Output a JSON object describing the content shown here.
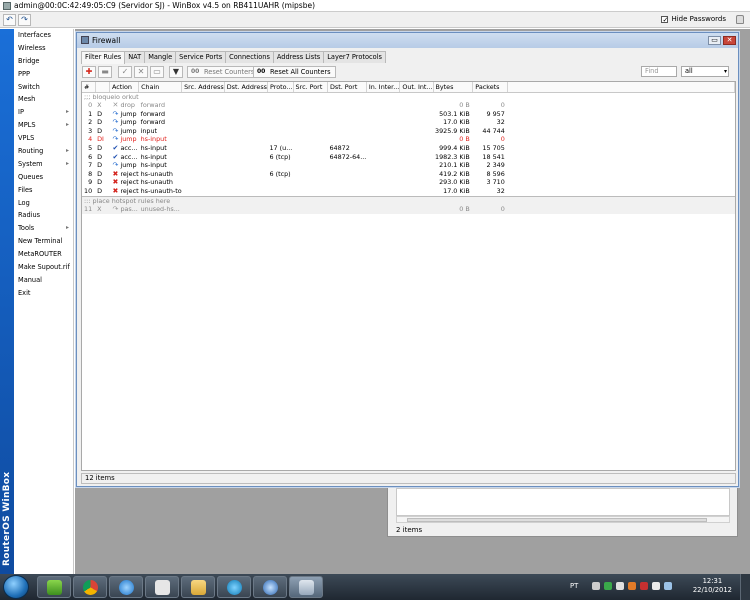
{
  "window": {
    "title": "admin@00:0C:42:49:05:C9 (Servidor SJ) - WinBox v4.5 on RB411UAHR (mipsbe)",
    "hide_passwords_label": "Hide Passwords",
    "hide_passwords_checked": "✓"
  },
  "brand": "RouterOS WinBox",
  "sidebar": {
    "items": [
      {
        "label": "Interfaces"
      },
      {
        "label": "Wireless"
      },
      {
        "label": "Bridge"
      },
      {
        "label": "PPP"
      },
      {
        "label": "Switch"
      },
      {
        "label": "Mesh"
      },
      {
        "label": "IP",
        "submenu": "▸"
      },
      {
        "label": "MPLS",
        "submenu": "▸"
      },
      {
        "label": "VPLS"
      },
      {
        "label": "Routing",
        "submenu": "▸"
      },
      {
        "label": "System",
        "submenu": "▸"
      },
      {
        "label": "Queues"
      },
      {
        "label": "Files"
      },
      {
        "label": "Log"
      },
      {
        "label": "Radius"
      },
      {
        "label": "Tools",
        "submenu": "▸"
      },
      {
        "label": "New Terminal"
      },
      {
        "label": "MetaROUTER"
      },
      {
        "label": "Make Supout.rif"
      },
      {
        "label": "Manual"
      },
      {
        "label": "Exit"
      }
    ]
  },
  "firewall": {
    "title": "Firewall",
    "tabs": [
      "Filter Rules",
      "NAT",
      "Mangle",
      "Service Ports",
      "Connections",
      "Address Lists",
      "Layer7 Protocols"
    ],
    "active_tab": 0,
    "toolbar": {
      "reset_counters": "Reset Counters",
      "reset_all_counters": "Reset All Counters",
      "reset_glyph": "00",
      "find_placeholder": "Find",
      "filter_value": "all"
    },
    "columns": [
      "#",
      "",
      "Action",
      "Chain",
      "Src. Address",
      "Dst. Address",
      "Proto...",
      "Src. Port",
      "Dst. Port",
      "In. Inter...",
      "Out. Int...",
      "Bytes",
      "Packets"
    ],
    "rows": [
      {
        "kind": "comment",
        "text": ";;; bloqueio orkut"
      },
      {
        "kind": "disabled",
        "n": "0",
        "f": "X",
        "icon": "drop",
        "action": "drop",
        "chain": "forward",
        "proto": "",
        "src_port": "",
        "dst_port": "",
        "bytes": "0 B",
        "packets": "0"
      },
      {
        "kind": "normal",
        "n": "1",
        "f": "D",
        "icon": "jump",
        "action": "jump",
        "chain": "forward",
        "proto": "",
        "src_port": "",
        "dst_port": "",
        "bytes": "503.1 KiB",
        "packets": "9 957"
      },
      {
        "kind": "normal",
        "n": "2",
        "f": "D",
        "icon": "jump",
        "action": "jump",
        "chain": "forward",
        "proto": "",
        "src_port": "",
        "dst_port": "",
        "bytes": "17.0 KiB",
        "packets": "32"
      },
      {
        "kind": "normal",
        "n": "3",
        "f": "D",
        "icon": "jump",
        "action": "jump",
        "chain": "input",
        "proto": "",
        "src_port": "",
        "dst_port": "",
        "bytes": "3925.9 KiB",
        "packets": "44 744"
      },
      {
        "kind": "red",
        "n": "4",
        "f": "DI",
        "icon": "jump",
        "action": "jump",
        "chain": "hs-input",
        "proto": "",
        "src_port": "",
        "dst_port": "",
        "bytes": "0 B",
        "packets": "0"
      },
      {
        "kind": "normal",
        "n": "5",
        "f": "D",
        "icon": "accept",
        "action": "acc...",
        "chain": "hs-input",
        "proto": "17 (u...",
        "src_port": "",
        "dst_port": "64872",
        "bytes": "999.4 KiB",
        "packets": "15 705"
      },
      {
        "kind": "normal",
        "n": "6",
        "f": "D",
        "icon": "accept",
        "action": "acc...",
        "chain": "hs-input",
        "proto": "6 (tcp)",
        "src_port": "",
        "dst_port": "64872-64...",
        "bytes": "1982.3 KiB",
        "packets": "18 541"
      },
      {
        "kind": "normal",
        "n": "7",
        "f": "D",
        "icon": "jump",
        "action": "jump",
        "chain": "hs-input",
        "proto": "",
        "src_port": "",
        "dst_port": "",
        "bytes": "210.1 KiB",
        "packets": "2 349"
      },
      {
        "kind": "normal",
        "n": "8",
        "f": "D",
        "icon": "reject",
        "action": "reject",
        "chain": "hs-unauth",
        "proto": "6 (tcp)",
        "src_port": "",
        "dst_port": "",
        "bytes": "419.2 KiB",
        "packets": "8 596"
      },
      {
        "kind": "normal",
        "n": "9",
        "f": "D",
        "icon": "reject",
        "action": "reject",
        "chain": "hs-unauth",
        "proto": "",
        "src_port": "",
        "dst_port": "",
        "bytes": "293.0 KiB",
        "packets": "3 710"
      },
      {
        "kind": "normal",
        "n": "10",
        "f": "D",
        "icon": "reject",
        "action": "reject",
        "chain": "hs-unauth-to",
        "proto": "",
        "src_port": "",
        "dst_port": "",
        "bytes": "17.0 KiB",
        "packets": "32"
      },
      {
        "kind": "hotspot-comment",
        "text": "::: place hotspot rules here"
      },
      {
        "kind": "hotspot",
        "n": "11",
        "f": "X",
        "icon": "passthrough",
        "action": "pas...",
        "chain": "unused-hs...",
        "proto": "",
        "src_port": "",
        "dst_port": "",
        "bytes": "0 B",
        "packets": "0"
      }
    ],
    "status": "12 items"
  },
  "secondary_window": {
    "status": "2 items"
  },
  "taskbar": {
    "language": "PT",
    "time": "12:31",
    "date": "22/10/2012"
  },
  "icons": {
    "drop": "✕",
    "jump": "↷",
    "accept": "✔",
    "reject": "✖",
    "passthrough": "↷",
    "add": "✚",
    "remove": "▬",
    "enable": "✓",
    "disable": "✕",
    "comment": "▭",
    "filter": "▼",
    "undo": "↶",
    "redo": "↷",
    "minimize": "▭",
    "close": "✕",
    "dropdown": "▾"
  },
  "colors": {
    "brand_blue": "#1a6fd8",
    "disabled_rule": "#e2201b",
    "titlebar_blue": "#b7cbe6"
  }
}
